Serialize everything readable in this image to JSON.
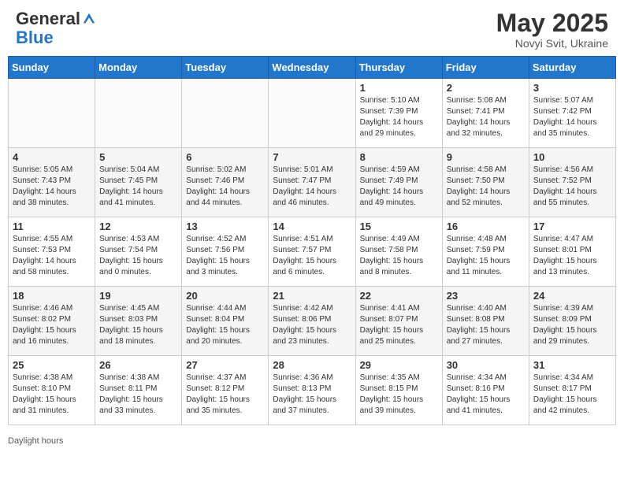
{
  "header": {
    "logo_general": "General",
    "logo_blue": "Blue",
    "month": "May 2025",
    "location": "Novyi Svit, Ukraine"
  },
  "weekdays": [
    "Sunday",
    "Monday",
    "Tuesday",
    "Wednesday",
    "Thursday",
    "Friday",
    "Saturday"
  ],
  "footer": {
    "daylight_label": "Daylight hours"
  },
  "weeks": [
    [
      {
        "day": "",
        "info": ""
      },
      {
        "day": "",
        "info": ""
      },
      {
        "day": "",
        "info": ""
      },
      {
        "day": "",
        "info": ""
      },
      {
        "day": "1",
        "info": "Sunrise: 5:10 AM\nSunset: 7:39 PM\nDaylight: 14 hours\nand 29 minutes."
      },
      {
        "day": "2",
        "info": "Sunrise: 5:08 AM\nSunset: 7:41 PM\nDaylight: 14 hours\nand 32 minutes."
      },
      {
        "day": "3",
        "info": "Sunrise: 5:07 AM\nSunset: 7:42 PM\nDaylight: 14 hours\nand 35 minutes."
      }
    ],
    [
      {
        "day": "4",
        "info": "Sunrise: 5:05 AM\nSunset: 7:43 PM\nDaylight: 14 hours\nand 38 minutes."
      },
      {
        "day": "5",
        "info": "Sunrise: 5:04 AM\nSunset: 7:45 PM\nDaylight: 14 hours\nand 41 minutes."
      },
      {
        "day": "6",
        "info": "Sunrise: 5:02 AM\nSunset: 7:46 PM\nDaylight: 14 hours\nand 44 minutes."
      },
      {
        "day": "7",
        "info": "Sunrise: 5:01 AM\nSunset: 7:47 PM\nDaylight: 14 hours\nand 46 minutes."
      },
      {
        "day": "8",
        "info": "Sunrise: 4:59 AM\nSunset: 7:49 PM\nDaylight: 14 hours\nand 49 minutes."
      },
      {
        "day": "9",
        "info": "Sunrise: 4:58 AM\nSunset: 7:50 PM\nDaylight: 14 hours\nand 52 minutes."
      },
      {
        "day": "10",
        "info": "Sunrise: 4:56 AM\nSunset: 7:52 PM\nDaylight: 14 hours\nand 55 minutes."
      }
    ],
    [
      {
        "day": "11",
        "info": "Sunrise: 4:55 AM\nSunset: 7:53 PM\nDaylight: 14 hours\nand 58 minutes."
      },
      {
        "day": "12",
        "info": "Sunrise: 4:53 AM\nSunset: 7:54 PM\nDaylight: 15 hours\nand 0 minutes."
      },
      {
        "day": "13",
        "info": "Sunrise: 4:52 AM\nSunset: 7:56 PM\nDaylight: 15 hours\nand 3 minutes."
      },
      {
        "day": "14",
        "info": "Sunrise: 4:51 AM\nSunset: 7:57 PM\nDaylight: 15 hours\nand 6 minutes."
      },
      {
        "day": "15",
        "info": "Sunrise: 4:49 AM\nSunset: 7:58 PM\nDaylight: 15 hours\nand 8 minutes."
      },
      {
        "day": "16",
        "info": "Sunrise: 4:48 AM\nSunset: 7:59 PM\nDaylight: 15 hours\nand 11 minutes."
      },
      {
        "day": "17",
        "info": "Sunrise: 4:47 AM\nSunset: 8:01 PM\nDaylight: 15 hours\nand 13 minutes."
      }
    ],
    [
      {
        "day": "18",
        "info": "Sunrise: 4:46 AM\nSunset: 8:02 PM\nDaylight: 15 hours\nand 16 minutes."
      },
      {
        "day": "19",
        "info": "Sunrise: 4:45 AM\nSunset: 8:03 PM\nDaylight: 15 hours\nand 18 minutes."
      },
      {
        "day": "20",
        "info": "Sunrise: 4:44 AM\nSunset: 8:04 PM\nDaylight: 15 hours\nand 20 minutes."
      },
      {
        "day": "21",
        "info": "Sunrise: 4:42 AM\nSunset: 8:06 PM\nDaylight: 15 hours\nand 23 minutes."
      },
      {
        "day": "22",
        "info": "Sunrise: 4:41 AM\nSunset: 8:07 PM\nDaylight: 15 hours\nand 25 minutes."
      },
      {
        "day": "23",
        "info": "Sunrise: 4:40 AM\nSunset: 8:08 PM\nDaylight: 15 hours\nand 27 minutes."
      },
      {
        "day": "24",
        "info": "Sunrise: 4:39 AM\nSunset: 8:09 PM\nDaylight: 15 hours\nand 29 minutes."
      }
    ],
    [
      {
        "day": "25",
        "info": "Sunrise: 4:38 AM\nSunset: 8:10 PM\nDaylight: 15 hours\nand 31 minutes."
      },
      {
        "day": "26",
        "info": "Sunrise: 4:38 AM\nSunset: 8:11 PM\nDaylight: 15 hours\nand 33 minutes."
      },
      {
        "day": "27",
        "info": "Sunrise: 4:37 AM\nSunset: 8:12 PM\nDaylight: 15 hours\nand 35 minutes."
      },
      {
        "day": "28",
        "info": "Sunrise: 4:36 AM\nSunset: 8:13 PM\nDaylight: 15 hours\nand 37 minutes."
      },
      {
        "day": "29",
        "info": "Sunrise: 4:35 AM\nSunset: 8:15 PM\nDaylight: 15 hours\nand 39 minutes."
      },
      {
        "day": "30",
        "info": "Sunrise: 4:34 AM\nSunset: 8:16 PM\nDaylight: 15 hours\nand 41 minutes."
      },
      {
        "day": "31",
        "info": "Sunrise: 4:34 AM\nSunset: 8:17 PM\nDaylight: 15 hours\nand 42 minutes."
      }
    ]
  ]
}
